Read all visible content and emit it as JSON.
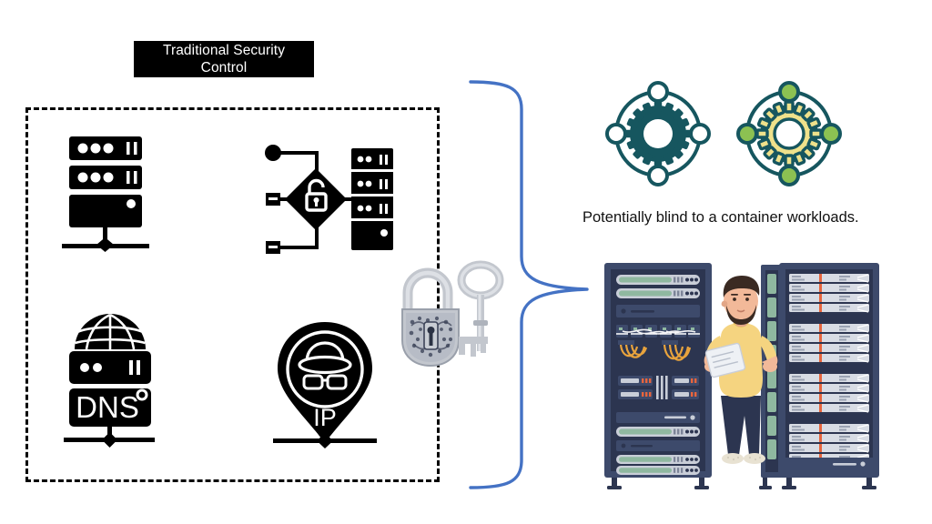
{
  "figure": {
    "title_box": {
      "label": "Traditional Security Control",
      "background": "#000000",
      "text_color": "#ffffff"
    },
    "caption": "Potentially blind to a container workloads.",
    "colors": {
      "brace": "#4472C4",
      "dashed_border": "#000000",
      "gear_dark": "#16565F",
      "gear_light_fill": "#EFE18B",
      "gear_node_green": "#8CC152",
      "rack_frame": "#3D4A6B",
      "rack_panel": "#2C3550",
      "rack_unit_green": "#8FB8A0",
      "rack_unit_grey": "#D8DCE4",
      "cable_orange": "#E8A33D",
      "shirt_yellow": "#F5D480",
      "pants_navy": "#2C3550",
      "skin": "#F2B999",
      "hair": "#3A2A22",
      "lock_grey": "#C3C7CE",
      "lock_detail": "#3C4358"
    },
    "left_panel": {
      "name": "traditional-security-control-group",
      "icons": [
        {
          "id": "server-stack",
          "label": "",
          "semantic": "server-stack-icon"
        },
        {
          "id": "firewall",
          "label": "",
          "semantic": "firewall-lock-icon"
        },
        {
          "id": "dns",
          "label": "DNS",
          "semantic": "dns-server-icon"
        },
        {
          "id": "ip",
          "label": "IP",
          "semantic": "ip-anonymity-pin-icon"
        }
      ],
      "overlay_icon": {
        "id": "lock-key",
        "semantic": "padlock-and-key-icon"
      }
    },
    "right_panel": {
      "gears": [
        {
          "id": "gear-dark",
          "semantic": "container-gear-dark-icon"
        },
        {
          "id": "gear-light",
          "semantic": "container-gear-light-icon"
        }
      ],
      "illustration": {
        "semantic": "datacenter-racks-technician-illustration",
        "racks": 2,
        "people": 1
      }
    }
  }
}
